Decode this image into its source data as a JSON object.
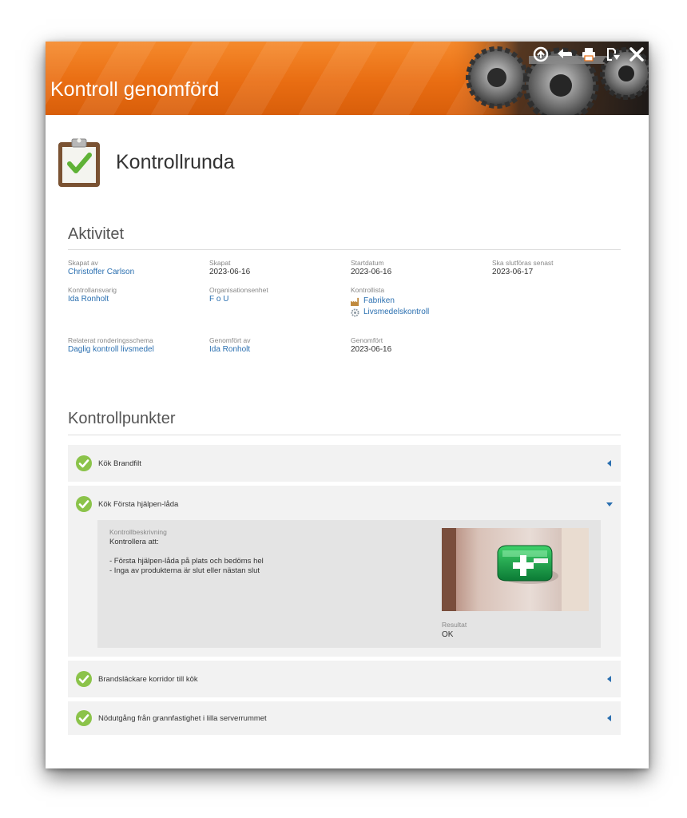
{
  "header": {
    "title": "Kontroll genomförd",
    "toolbar": [
      {
        "icon": "share-icon"
      },
      {
        "icon": "back-arrow-icon"
      },
      {
        "icon": "print-icon"
      },
      {
        "icon": "export-icon"
      },
      {
        "icon": "close-icon"
      }
    ]
  },
  "page": {
    "icon": "clipboard-check-icon",
    "title": "Kontrollrunda"
  },
  "activity": {
    "title": "Aktivitet",
    "fields": {
      "skapat_av": {
        "label": "Skapat av",
        "value": "Christoffer Carlson"
      },
      "skapat": {
        "label": "Skapat",
        "value": "2023-06-16"
      },
      "startdatum": {
        "label": "Startdatum",
        "value": "2023-06-16"
      },
      "slutforas": {
        "label": "Ska slutföras senast",
        "value": "2023-06-17"
      },
      "kontrollansvarig": {
        "label": "Kontrollansvarig",
        "value": "Ida Ronholt"
      },
      "org": {
        "label": "Organisationsenhet",
        "value": "F o U"
      },
      "kontrollista": {
        "label": "Kontrollista",
        "items": [
          "Fabriken",
          "Livsmedelskontroll"
        ]
      },
      "relaterat": {
        "label": "Relaterat ronderingsschema",
        "value": "Daglig kontroll livsmedel"
      },
      "genomfort_av": {
        "label": "Genomfört av",
        "value": "Ida Ronholt"
      },
      "genomfort": {
        "label": "Genomfört",
        "value": "2023-06-16"
      }
    }
  },
  "checkpoints": {
    "title": "Kontrollpunkter",
    "items": [
      {
        "label": "Kök Brandfilt",
        "expanded": false
      },
      {
        "label": "Kök Första hjälpen-låda",
        "expanded": true,
        "description_label": "Kontrollbeskrivning",
        "description_lines": [
          "Kontrollera att:",
          "",
          "- Första hjälpen-låda på plats och bedöms hel",
          "- Inga av produkterna är slut eller nästan slut"
        ],
        "result_label": "Resultat",
        "result_value": "OK"
      },
      {
        "label": "Brandsläckare korridor till kök",
        "expanded": false
      },
      {
        "label": "Nödutgång från grannfastighet i lilla serverrummet",
        "expanded": false
      }
    ]
  },
  "colors": {
    "header_orange": "#ed7318",
    "link_blue": "#2a6fb0",
    "check_green": "#8bc34a"
  }
}
